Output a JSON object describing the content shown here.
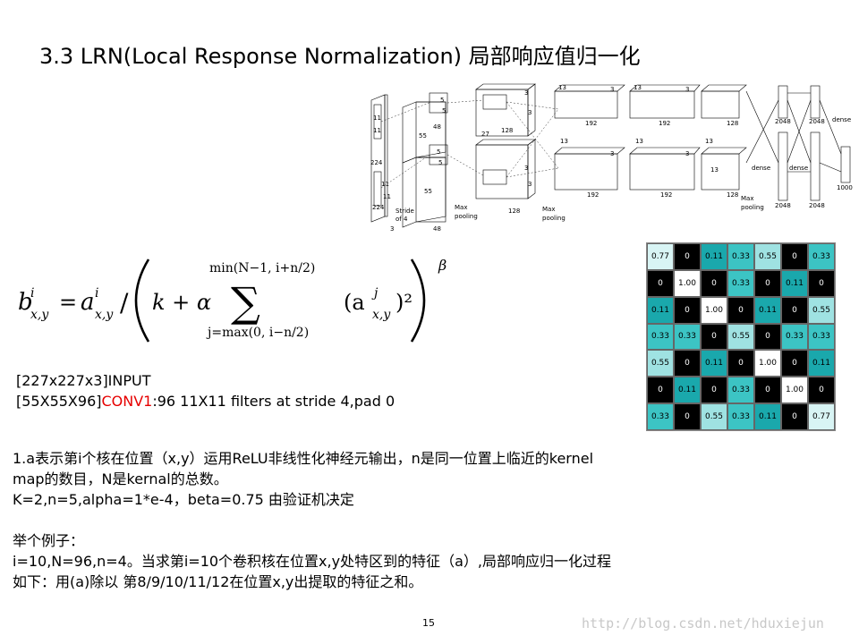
{
  "slide": {
    "title": "3.3 LRN(Local Response Normalization) 局部响应值归一化",
    "page_number": "15",
    "watermark": "http://blog.csdn.net/hduxiejun"
  },
  "architecture_figure": {
    "labels": {
      "in_224_a": "224",
      "in_224_b": "224",
      "in_3": "3",
      "k11_a": "11",
      "k11_b": "11",
      "k11_c": "11",
      "k11_d": "11",
      "stride": "Stride",
      "of4": "of 4",
      "c1_55_a": "55",
      "c1_55_b": "55",
      "c1_48_a": "48",
      "c1_48_b": "48",
      "k5_a": "5",
      "k5_b": "5",
      "k5_c": "5",
      "k5_d": "5",
      "c2_27": "27",
      "c2_128_a": "128",
      "c2_128_b": "128",
      "k3_a": "3",
      "k3_b": "3",
      "k3_c": "3",
      "k3_d": "3",
      "k3_e": "3",
      "k3_f": "3",
      "k3_g": "3",
      "k3_h": "3",
      "c3_13_a": "13",
      "c3_13_b": "13",
      "c3_13_c": "13",
      "c3_13_d": "13",
      "c3_13_e": "13",
      "c3_13_f": "13",
      "c3_192_a": "192",
      "c3_192_b": "192",
      "c4_192_a": "192",
      "c4_192_b": "192",
      "c5_128_a": "128",
      "c5_128_b": "128",
      "fc_2048_a": "2048",
      "fc_2048_b": "2048",
      "fc_2048_c": "2048",
      "fc_2048_d": "2048",
      "dense_a": "dense",
      "dense_b": "dense",
      "dense_c": "dense",
      "out_1000": "1000",
      "maxpool_a": "Max",
      "maxpool_b": "pooling",
      "maxpool_c": "Max",
      "maxpool_d": "pooling",
      "maxpool_e": "Max",
      "maxpool_f": "pooling"
    }
  },
  "formula": {
    "b": "b",
    "b_sup": "i",
    "b_sub": "x,y",
    "eq": "=",
    "a": "a",
    "a_sup": "i",
    "a_sub": "x,y",
    "slash": "/",
    "k_plus_alpha": "k + α",
    "sigma": "∑",
    "upper": "min(N−1, i+n/2)",
    "lower": "j=max(0, i−n/2)",
    "term": "(a",
    "term_sup": "j",
    "term_sub": "x,y",
    "term_close": ")²",
    "beta": "β"
  },
  "matrix": {
    "rows": [
      [
        "0.77",
        "0",
        "0.11",
        "0.33",
        "0.55",
        "0",
        "0.33"
      ],
      [
        "0",
        "1.00",
        "0",
        "0.33",
        "0",
        "0.11",
        "0"
      ],
      [
        "0.11",
        "0",
        "1.00",
        "0",
        "0.11",
        "0",
        "0.55"
      ],
      [
        "0.33",
        "0.33",
        "0",
        "0.55",
        "0",
        "0.33",
        "0.33"
      ],
      [
        "0.55",
        "0",
        "0.11",
        "0",
        "1.00",
        "0",
        "0.11"
      ],
      [
        "0",
        "0.11",
        "0",
        "0.33",
        "0",
        "1.00",
        "0"
      ],
      [
        "0.33",
        "0",
        "0.55",
        "0.33",
        "0.11",
        "0",
        "0.77"
      ]
    ]
  },
  "layer_lines": {
    "input": "[227x227x3]INPUT",
    "conv_prefix": "[55X55X96]",
    "conv_name": "CONV1",
    "conv_suffix": ":96 11X11 filters at stride 4,pad 0"
  },
  "paragraph": {
    "line1": "1.a表示第i个核在位置（x,y）运用ReLU非线性化神经元输出，n是同一位置上临近的kernel",
    "line2": "map的数目，N是kernal的总数。",
    "line3": "K=2,n=5,alpha=1*e-4，beta=0.75 由验证机决定",
    "line4": "举个例子：",
    "line5": "i=10,N=96,n=4。当求第i=10个卷积核在位置x,y处特区到的特征（a）,局部响应归一化过程",
    "line6": "如下：用(a)除以 第8/9/10/11/12在位置x,y出提取的特征之和。"
  },
  "colors": {
    "accent_red": "#e60000"
  }
}
